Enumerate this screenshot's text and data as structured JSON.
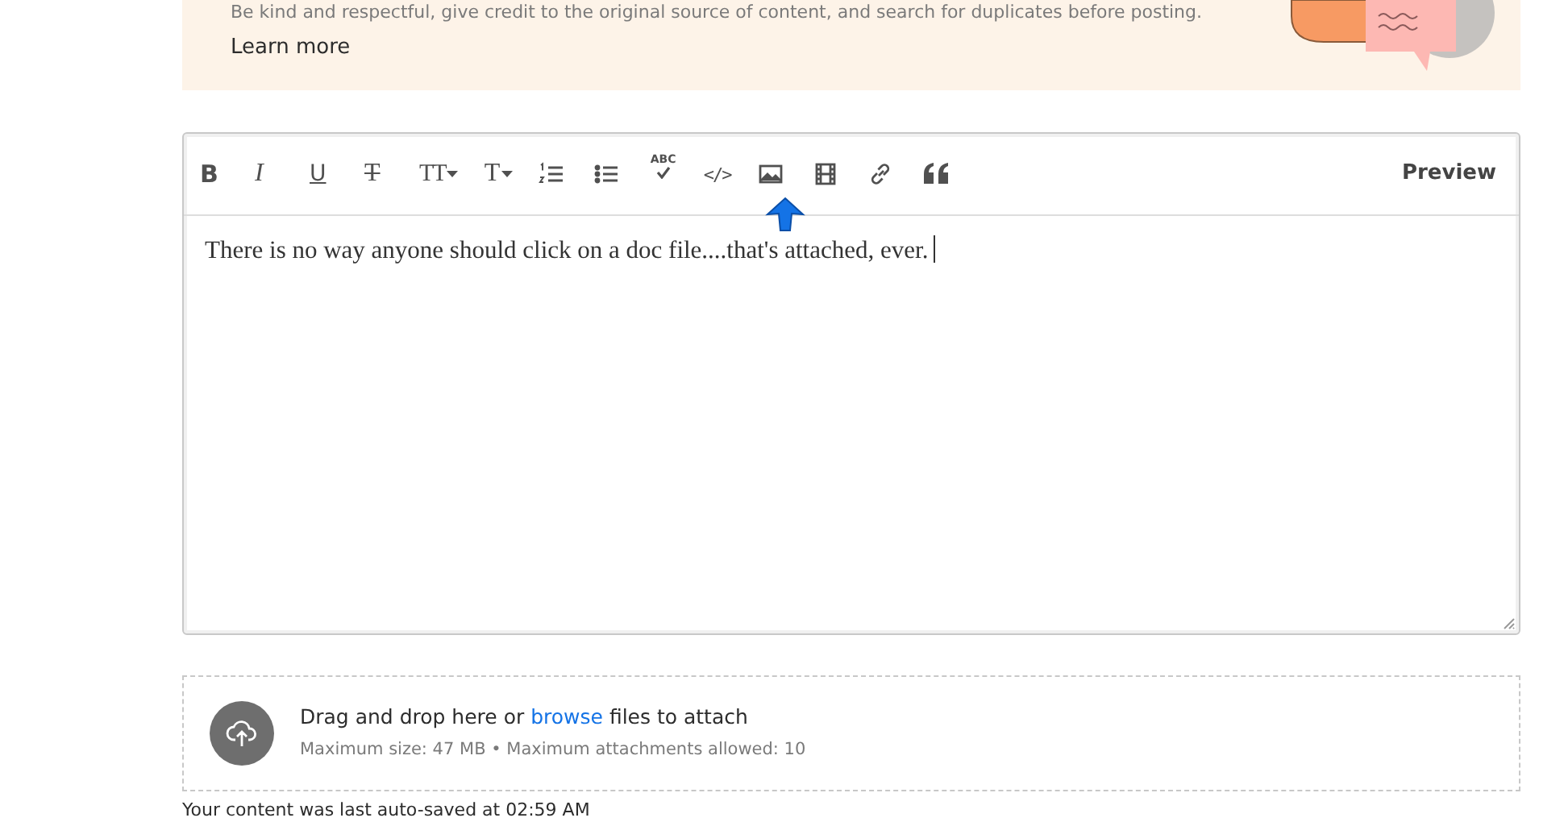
{
  "banner": {
    "message": "Be kind and respectful, give credit to the original source of content, and search for duplicates before posting.",
    "link": "Learn more"
  },
  "editor": {
    "toolbar": [
      {
        "kind": "bold",
        "label": "B"
      },
      {
        "kind": "italic",
        "label": "I"
      },
      {
        "kind": "underline",
        "label": "U"
      },
      {
        "kind": "strikethrough",
        "label": "T"
      },
      {
        "kind": "font-size",
        "label": "TT",
        "dropdown": true
      },
      {
        "kind": "text-style",
        "label": "T",
        "dropdown": true
      },
      {
        "kind": "numbered-list"
      },
      {
        "kind": "bulleted-list"
      },
      {
        "kind": "spellcheck",
        "label": "ABC"
      },
      {
        "kind": "code",
        "label": "</>"
      },
      {
        "kind": "image"
      },
      {
        "kind": "video"
      },
      {
        "kind": "link"
      },
      {
        "kind": "quote"
      }
    ],
    "preview": "Preview",
    "content": "There is no way anyone should click on a doc file....that's attached, ever."
  },
  "attach": {
    "before": "Drag and drop here or",
    "link": "browse",
    "after": "files to attach",
    "limits": "Maximum size: 47 MB • Maximum attachments allowed: 10"
  },
  "autosave": "Your content was last auto-saved at 02:59 AM"
}
